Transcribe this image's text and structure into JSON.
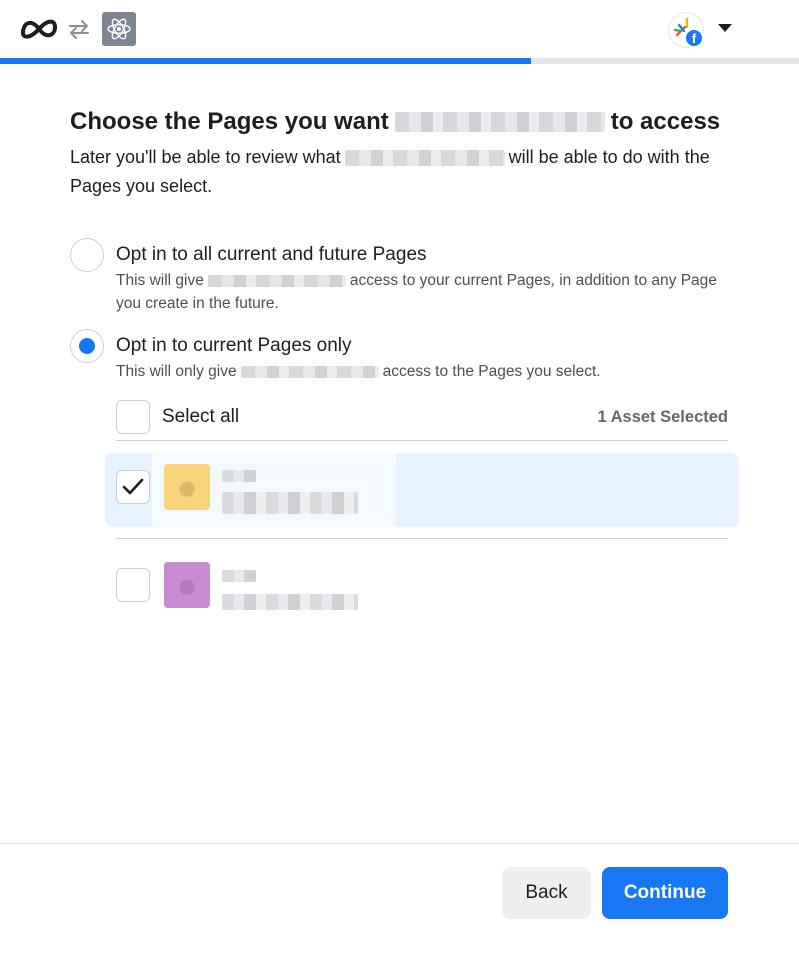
{
  "header": {
    "logo": "meta-logo-icon",
    "swap_icon": "swap-arrows-icon",
    "app_icon": "atom-icon",
    "account_badge": "f",
    "progress": 0.665,
    "colors": {
      "accent": "#1877f2",
      "track": "#e4e6eb"
    }
  },
  "main": {
    "title_prefix": "Choose the Pages you want",
    "title_suffix": "to access",
    "subtitle_prefix": "Later you'll be able to review what",
    "subtitle_suffix": "will be able to do with the Pages you select."
  },
  "options": [
    {
      "label": "Opt in to all current and future Pages",
      "desc_prefix": "This will give",
      "desc_suffix": "access to your current Pages, in addition to any Page you create in the future.",
      "selected": false
    },
    {
      "label": "Opt in to current Pages only",
      "desc_prefix": "This will only give",
      "desc_suffix": "access to the Pages you select.",
      "selected": true
    }
  ],
  "pages_list": {
    "select_all_label": "Select all",
    "asset_count": "1 Asset Selected",
    "items": [
      {
        "checked": true,
        "thumb_color": "#f8d37a"
      },
      {
        "checked": false,
        "thumb_color": "#c88ad0"
      }
    ]
  },
  "footer": {
    "back_label": "Back",
    "continue_label": "Continue"
  }
}
